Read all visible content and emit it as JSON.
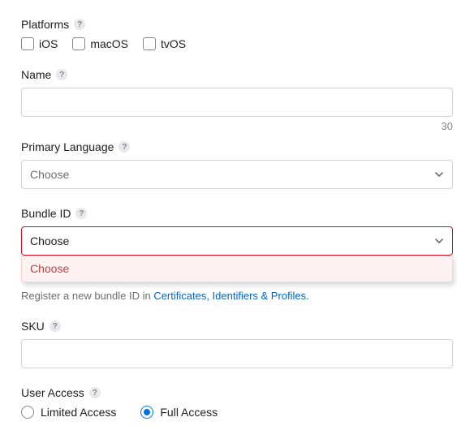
{
  "platforms": {
    "label": "Platforms",
    "options": [
      {
        "value": "iOS",
        "checked": false
      },
      {
        "value": "macOS",
        "checked": false
      },
      {
        "value": "tvOS",
        "checked": false
      }
    ]
  },
  "name": {
    "label": "Name",
    "value": "",
    "remaining": "30"
  },
  "primaryLanguage": {
    "label": "Primary Language",
    "placeholder": "Choose"
  },
  "bundleId": {
    "label": "Bundle ID",
    "placeholder": "Choose",
    "dropdownOption": "Choose",
    "hintPrefix": "Register a new bundle ID in ",
    "hintLink": "Certificates, Identifiers & Profiles."
  },
  "sku": {
    "label": "SKU",
    "value": ""
  },
  "userAccess": {
    "label": "User Access",
    "options": [
      {
        "value": "Limited Access",
        "selected": false
      },
      {
        "value": "Full Access",
        "selected": true
      }
    ]
  }
}
